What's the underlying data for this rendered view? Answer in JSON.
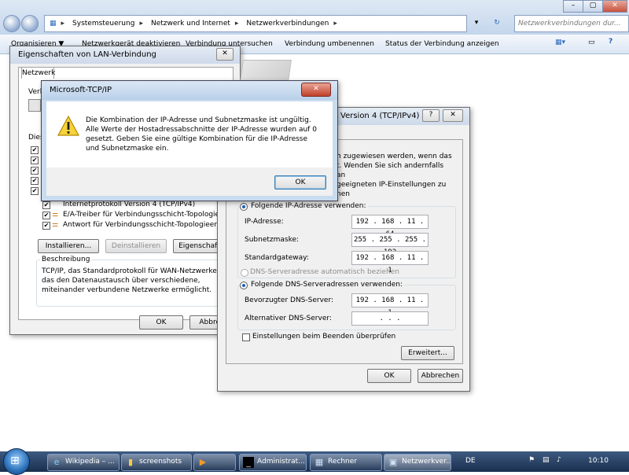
{
  "explorer": {
    "breadcrumb": [
      "Systemsteuerung",
      "Netzwerk und Internet",
      "Netzwerkverbindungen"
    ],
    "search_placeholder": "Netzwerkverbindungen dur...",
    "commands": [
      "Organisieren ▼",
      "Netzwerkgerät deaktivieren",
      "Verbindung untersuchen",
      "Verbindung umbenennen",
      "Status der Verbindung anzeigen"
    ]
  },
  "lan_dialog": {
    "title": "Eigenschaften von LAN-Verbindung",
    "tab": "Netzwerk",
    "partial_label_connect": "Verb",
    "partial_label_list": "Dies",
    "items": [
      {
        "label": "Internetprotokoll Version 4 (TCP/IPv4)",
        "checked": true
      },
      {
        "label": "E/A-Treiber für Verbindungsschicht-Topologieerkennu...",
        "checked": true
      },
      {
        "label": "Antwort für Verbindungsschicht-Topologieerkennung",
        "checked": true
      }
    ],
    "buttons": {
      "install": "Installieren...",
      "uninstall": "Deinstallieren",
      "properties": "Eigenschaften"
    },
    "description_title": "Beschreibung",
    "description": "TCP/IP, das Standardprotokoll für WAN-Netzwerke, das den Datenaustausch über verschiedene, miteinander verbundene Netzwerke ermöglicht.",
    "ok": "OK",
    "cancel": "Abbrech"
  },
  "ipv4_dialog": {
    "title": "Version 4 (TCP/IPv4)",
    "help": "?",
    "intro_lines": [
      "h zugewiesen werden, wenn das",
      "t. Wenden Sie sich andernfalls an",
      "geeigneten IP-Einstellungen zu"
    ],
    "partial_obtain": "nen",
    "radio_use_ip": "Folgende IP-Adresse verwenden:",
    "ip_label": "IP-Adresse:",
    "ip_value": "192 . 168 . 11 . 64",
    "subnet_label": "Subnetzmaske:",
    "subnet_value": "255 . 255 . 255 . 192",
    "gateway_label": "Standardgateway:",
    "gateway_value": "192 . 168 . 11 . 1",
    "dns_auto": "DNS-Serveradresse automatisch beziehen",
    "dns_use": "Folgende DNS-Serveradressen verwenden:",
    "dns_pref_label": "Bevorzugter DNS-Server:",
    "dns_pref_value": "192 . 168 . 11 . 1",
    "dns_alt_label": "Alternativer DNS-Server:",
    "dns_alt_value": ".   .   .",
    "validate_label": "Einstellungen beim Beenden überprüfen",
    "advanced": "Erweitert...",
    "ok": "OK",
    "cancel": "Abbrechen"
  },
  "alert": {
    "title": "Microsoft-TCP/IP",
    "message": "Die Kombination der IP-Adresse und Subnetzmaske ist ungültig. Alle Werte der Hostadressabschnitte der IP-Adresse wurden auf 0 gesetzt. Geben Sie eine gültige Kombination für die IP-Adresse und Subnetzmaske ein.",
    "ok": "OK"
  },
  "taskbar": {
    "items": [
      "Wikipedia – ...",
      "screenshots",
      "",
      "Administrat...",
      "Rechner",
      "Netzwerkver..."
    ],
    "lang": "DE",
    "time": "10:10"
  }
}
